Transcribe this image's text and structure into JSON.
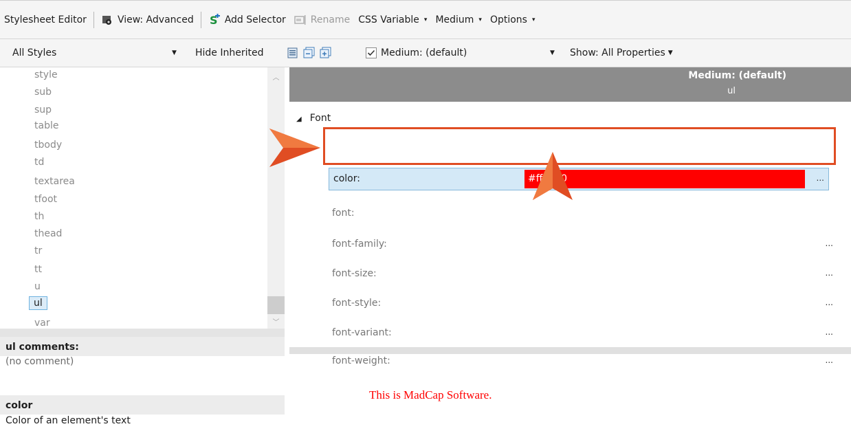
{
  "toolbar1": {
    "title": "Stylesheet Editor",
    "view": "View: Advanced",
    "add_selector": "Add Selector",
    "rename": "Rename",
    "css_variable": "CSS Variable",
    "medium": "Medium",
    "options": "Options"
  },
  "toolbar2": {
    "styles_filter": "All Styles",
    "hide_inherited": "Hide Inherited",
    "medium_select": "Medium: (default)",
    "show": "Show: All Properties"
  },
  "style_list": {
    "items": [
      "style",
      "sub",
      "sup",
      "table",
      "tbody",
      "td",
      "textarea",
      "tfoot",
      "th",
      "thead",
      "tr",
      "tt",
      "u",
      "ul",
      "var"
    ],
    "selected": "ul"
  },
  "comments": {
    "header": "ul comments:",
    "comment": "(no comment)",
    "property_header": "color",
    "property_desc": "Color of an element's text"
  },
  "properties": {
    "column_medium": "Medium: (default)",
    "column_selector": "ul",
    "group": "Font",
    "color_label": "color:",
    "color_value": "#ff0000",
    "dots": "...",
    "rows": [
      "font:",
      "font-family:",
      "font-size:",
      "font-style:",
      "font-variant:",
      "font-weight:"
    ]
  },
  "preview": {
    "text": "This is MadCap Software."
  },
  "colors": {
    "accent": "#e04d23",
    "value_bg": "#ff0000",
    "row_highlight": "#d4e9f7"
  }
}
